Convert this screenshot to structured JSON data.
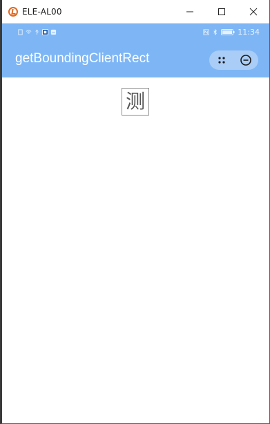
{
  "window": {
    "title": "ELE-AL00",
    "controls": [
      "minimize",
      "maximize",
      "close"
    ]
  },
  "status_bar": {
    "time": "11:34",
    "left_icons": [
      "sim-icon",
      "wifi-icon",
      "usb-icon",
      "app-notification-icon",
      "sd-icon"
    ],
    "right_icons": [
      "nfc-icon",
      "bluetooth-icon",
      "battery-icon"
    ]
  },
  "nav_bar": {
    "title": "getBoundingClientRect",
    "capsule": [
      "more-icon",
      "close-circle-icon"
    ]
  },
  "content": {
    "test_char": "测"
  },
  "colors": {
    "accent": "#7eb6f5",
    "capsule": "#a9cdf7",
    "app_icon": "#e2671f"
  }
}
